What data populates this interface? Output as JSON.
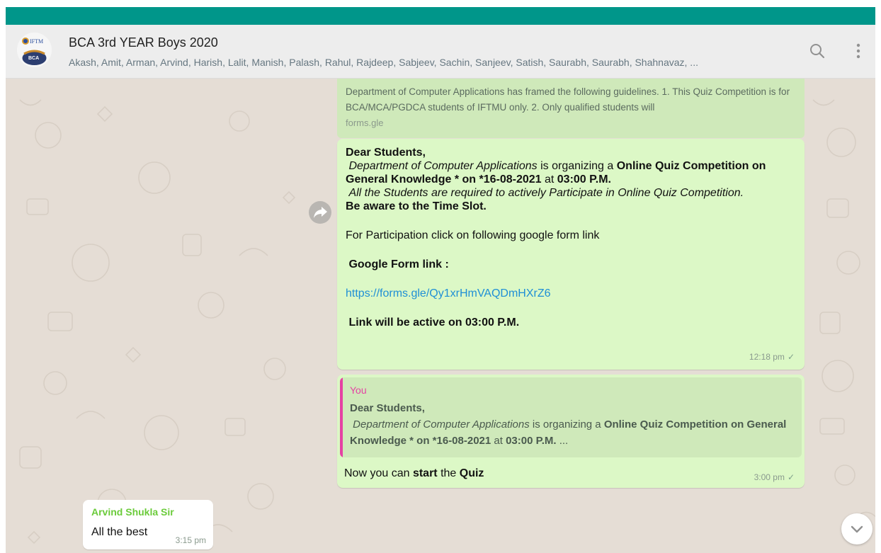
{
  "header": {
    "group_name": "BCA 3rd YEAR Boys 2020",
    "members": "Akash, Amit, Arman, Arvind, Harish, Lalit, Manish, Palash, Rahul, Rajdeep, Sabjeev, Sachin, Sanjeev, Satish, Saurabh, Saurabh, Shahnavaz, ...",
    "avatar_text_top": "IFTM",
    "avatar_text_bottom": "BCA",
    "icons": [
      "search-icon",
      "menu-icon"
    ]
  },
  "link_preview": {
    "description": "Department of Computer Applications has framed the following guidelines. 1. This Quiz Competition is for BCA/MCA/PGDCA students of IFTMU only. 2. Only qualified students will",
    "domain": "forms.gle"
  },
  "message1": {
    "greeting": "Dear Students,",
    "l2_italic": "Department of Computer Applications",
    "l2_mid": " is organizing a ",
    "l2_bold": "Online Quiz Competition on General Knowledge *    on *16-08-2021",
    "l2_at": " at ",
    "l2_time": "03:00 P.M.",
    "l3": "All the Students are required to actively Participate in Online Quiz Competition.",
    "l4": "Be  aware to the Time Slot.",
    "l5": "For Participation click on following google form link",
    "l6": "Google Form link :",
    "link": "https://forms.gle/Qy1xrHmVAQDmHXrZ6",
    "l7": "Link will be active on 03:00 P.M.",
    "time": "12:18 pm",
    "tick": "✓"
  },
  "message2": {
    "quote_author": "You",
    "quote_greeting": "Dear Students,",
    "quote_italic": "Department of Computer Applications",
    "quote_mid": " is organizing a ",
    "quote_bold": "Online Quiz Competition on General Knowledge *    on *16-08-2021",
    "quote_at": " at ",
    "quote_time": "03:00 P.M.",
    "quote_end": " ...",
    "t1": "Now you can ",
    "t2": "start",
    "t3": " the ",
    "t4": "Quiz",
    "time": "3:00 pm",
    "tick": "✓"
  },
  "message3": {
    "sender": "Arvind Shukla Sir",
    "text": "All the best",
    "time": "3:15 pm"
  },
  "colors": {
    "topbar": "#00968a",
    "chat_bg": "#e5ddd5",
    "outgoing": "#dcf8c6",
    "quote_bar": "#e542a3",
    "sender_name": "#6bcb3b",
    "link": "#1f8fd6"
  }
}
